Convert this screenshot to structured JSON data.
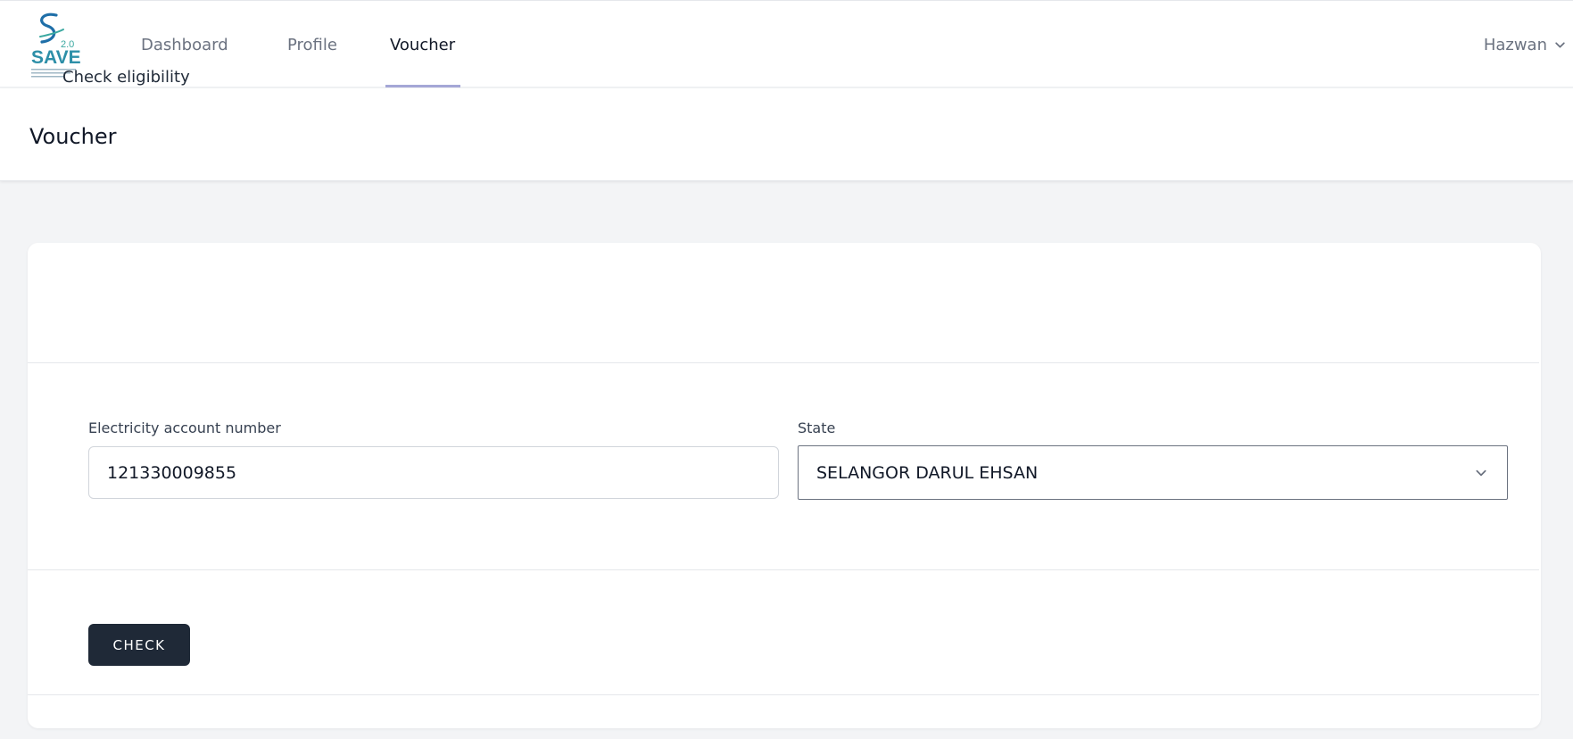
{
  "logo": {
    "text": "SAVE",
    "version": "2.0"
  },
  "nav": {
    "links": [
      {
        "label": "Dashboard",
        "active": false
      },
      {
        "label": "Profile",
        "active": false
      },
      {
        "label": "Voucher",
        "active": true
      }
    ],
    "user": {
      "name": "Hazwan",
      "icon": "chevron-down-icon"
    }
  },
  "page": {
    "title": "Voucher"
  },
  "card": {
    "title": "Check eligibility",
    "account_field": {
      "label": "Electricity account number",
      "value": "121330009855"
    },
    "state_field": {
      "label": "State",
      "value": "SELANGOR DARUL EHSAN",
      "icon": "chevron-down-icon"
    },
    "submit_label": "CHECK"
  },
  "colors": {
    "primary_button": "#1f2937",
    "logo_blue": "#1f6fa8",
    "logo_teal": "#3aa8a0",
    "active_underline": "#a5a7d6",
    "page_background": "#f3f4f6"
  }
}
